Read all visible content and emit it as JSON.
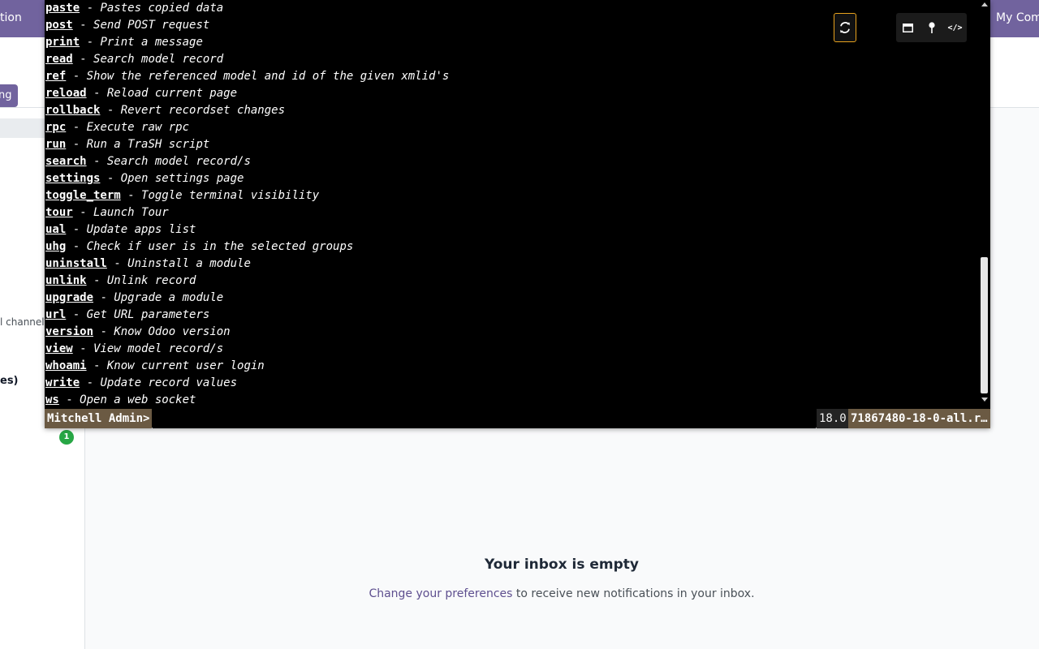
{
  "background": {
    "navbar_left_text": "tion",
    "navbar_right_text": "My Com",
    "start_button_fragment": "ng",
    "sidebar_channel_fragment": "l channel",
    "sidebar_section_fragment": "es)",
    "counter_badge": "1",
    "inbox_title": "Your inbox is empty",
    "inbox_link": "Change your preferences",
    "inbox_text": " to receive new notifications in your inbox."
  },
  "terminal": {
    "lines": [
      {
        "cmd": "paste",
        "desc": "Pastes copied data"
      },
      {
        "cmd": "post",
        "desc": "Send POST request"
      },
      {
        "cmd": "print",
        "desc": "Print a message"
      },
      {
        "cmd": "read",
        "desc": "Search model record"
      },
      {
        "cmd": "ref",
        "desc": "Show the referenced model and id of the given xmlid's"
      },
      {
        "cmd": "reload",
        "desc": "Reload current page"
      },
      {
        "cmd": "rollback",
        "desc": "Revert recordset changes"
      },
      {
        "cmd": "rpc",
        "desc": "Execute raw rpc"
      },
      {
        "cmd": "run",
        "desc": "Run a TraSH script"
      },
      {
        "cmd": "search",
        "desc": "Search model record/s"
      },
      {
        "cmd": "settings",
        "desc": "Open settings page"
      },
      {
        "cmd": "toggle_term",
        "desc": "Toggle terminal visibility"
      },
      {
        "cmd": "tour",
        "desc": "Launch Tour"
      },
      {
        "cmd": "ual",
        "desc": "Update apps list"
      },
      {
        "cmd": "uhg",
        "desc": "Check if user is in the selected groups"
      },
      {
        "cmd": "uninstall",
        "desc": "Uninstall a module"
      },
      {
        "cmd": "unlink",
        "desc": "Unlink record"
      },
      {
        "cmd": "upgrade",
        "desc": "Upgrade a module"
      },
      {
        "cmd": "url",
        "desc": "Get URL parameters"
      },
      {
        "cmd": "version",
        "desc": "Know Odoo version"
      },
      {
        "cmd": "view",
        "desc": "View model record/s"
      },
      {
        "cmd": "whoami",
        "desc": "Know current user login"
      },
      {
        "cmd": "write",
        "desc": "Update record values"
      },
      {
        "cmd": "ws",
        "desc": "Open a web socket"
      }
    ],
    "separator": " - ",
    "prompt": "Mitchell Admin>",
    "input_value": "",
    "version": "18.0",
    "database": "71867480-18-0-all.r…",
    "tools": [
      {
        "icon": "window-icon"
      },
      {
        "icon": "pin-icon"
      },
      {
        "icon": "code-icon",
        "glyph": "</>"
      }
    ],
    "colors": {
      "accent_border": "#e8a21d",
      "prompt_bg": "#6b5a43"
    }
  }
}
